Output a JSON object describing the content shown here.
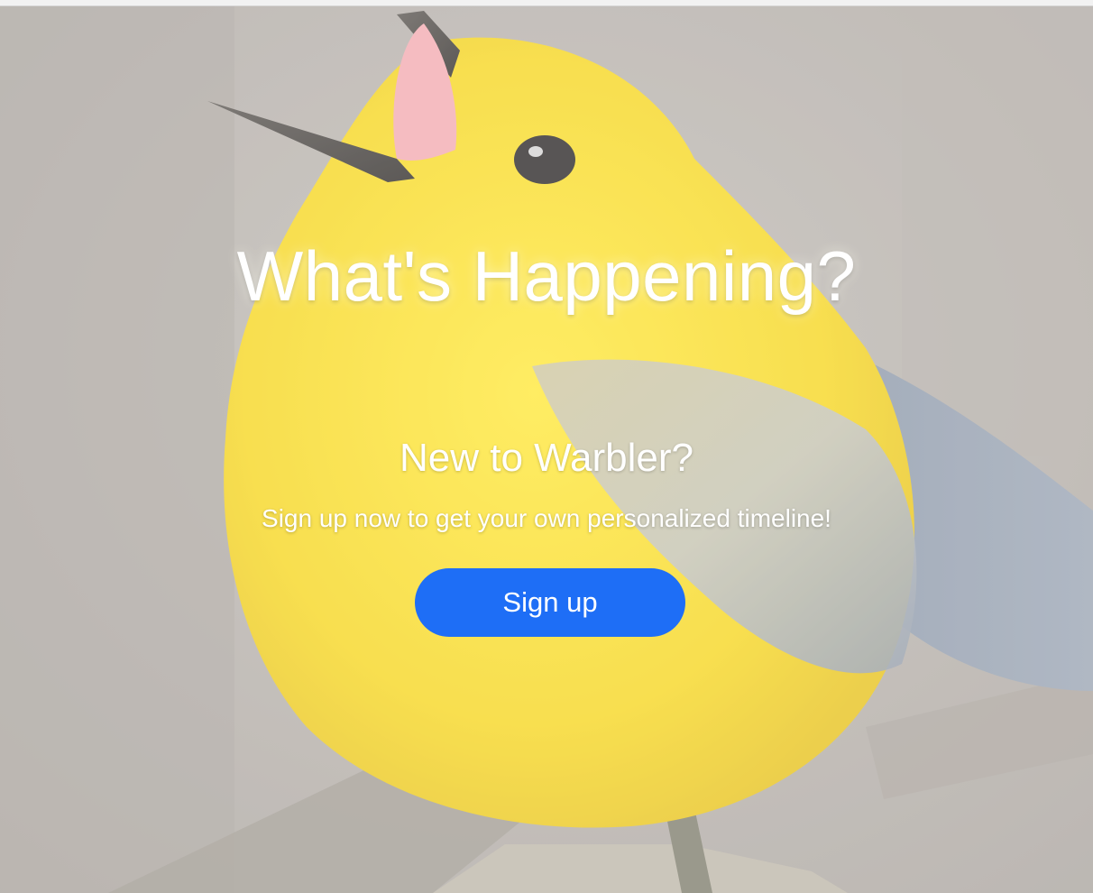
{
  "hero": {
    "title": "What's Happening?",
    "subtitle": "New to Warbler?",
    "tagline": "Sign up now to get your own personalized timeline!",
    "signup_label": "Sign up"
  },
  "colors": {
    "button_bg": "#1e6ef6",
    "bird_yellow": "#f7e430",
    "background": "#b8b2ad"
  }
}
